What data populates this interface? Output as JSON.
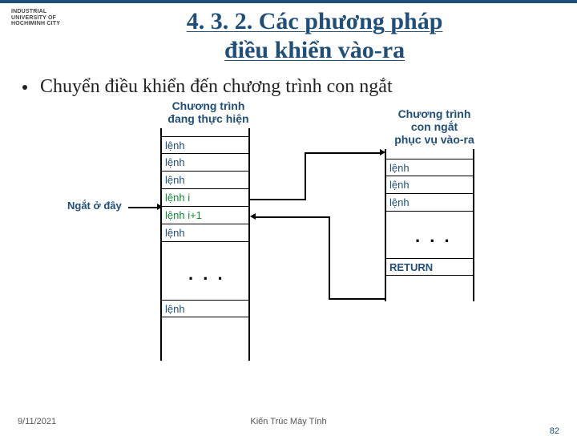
{
  "logo": {
    "text_l1": "INDUSTRIAL",
    "text_l2": "UNIVERSITY OF",
    "text_l3": "HOCHIMINH CITY"
  },
  "title": {
    "line1": "4. 3. 2. Các phương pháp",
    "line2": "điều khiển vào-ra"
  },
  "bullet": "Chuyển điều khiển đến chương trình con ngắt",
  "diagram": {
    "left_header_l1": "Chương trình",
    "left_header_l2": "đang thực hiện",
    "right_header_l1": "Chương trình",
    "right_header_l2": "con ngắt",
    "right_header_l3": "phục vụ vào-ra",
    "interrupt_label": "Ngắt ở đây",
    "left_cells": [
      "lệnh",
      "lệnh",
      "lệnh",
      "lệnh i",
      "lệnh i+1",
      "lệnh"
    ],
    "left_last": "lệnh",
    "right_cells": [
      "lệnh",
      "lệnh",
      "lệnh"
    ],
    "right_return": "RETURN",
    "ellipsis": ". . ."
  },
  "footer": {
    "date": "9/11/2021",
    "center": "Kiến Trúc Máy Tính",
    "page": "82"
  }
}
